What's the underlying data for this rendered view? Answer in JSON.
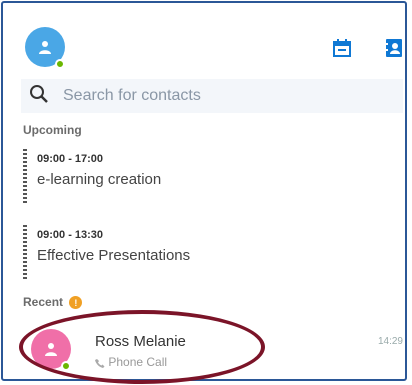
{
  "app": {
    "presence": "online",
    "colors": {
      "accent": "#2b5797",
      "avatar": "#4aa7e6",
      "presence": "#6bb700",
      "contact_avatar": "#f06fa8",
      "badge": "#f0a024",
      "highlight": "#7b1428"
    },
    "icons": [
      "user-avatar-icon",
      "calendar-icon",
      "contacts-book-icon",
      "search-icon",
      "phone-icon"
    ]
  },
  "search": {
    "placeholder": "Search for contacts"
  },
  "upcoming": {
    "heading": "Upcoming",
    "events": [
      {
        "time": "09:00 - 17:00",
        "title": "e-learning creation"
      },
      {
        "time": "09:00 - 13:30",
        "title": "Effective Presentations"
      }
    ]
  },
  "recent": {
    "heading": "Recent",
    "badge": "!",
    "items": [
      {
        "name": "Ross Melanie",
        "subtitle": "Phone Call",
        "time": "14:29"
      }
    ]
  }
}
